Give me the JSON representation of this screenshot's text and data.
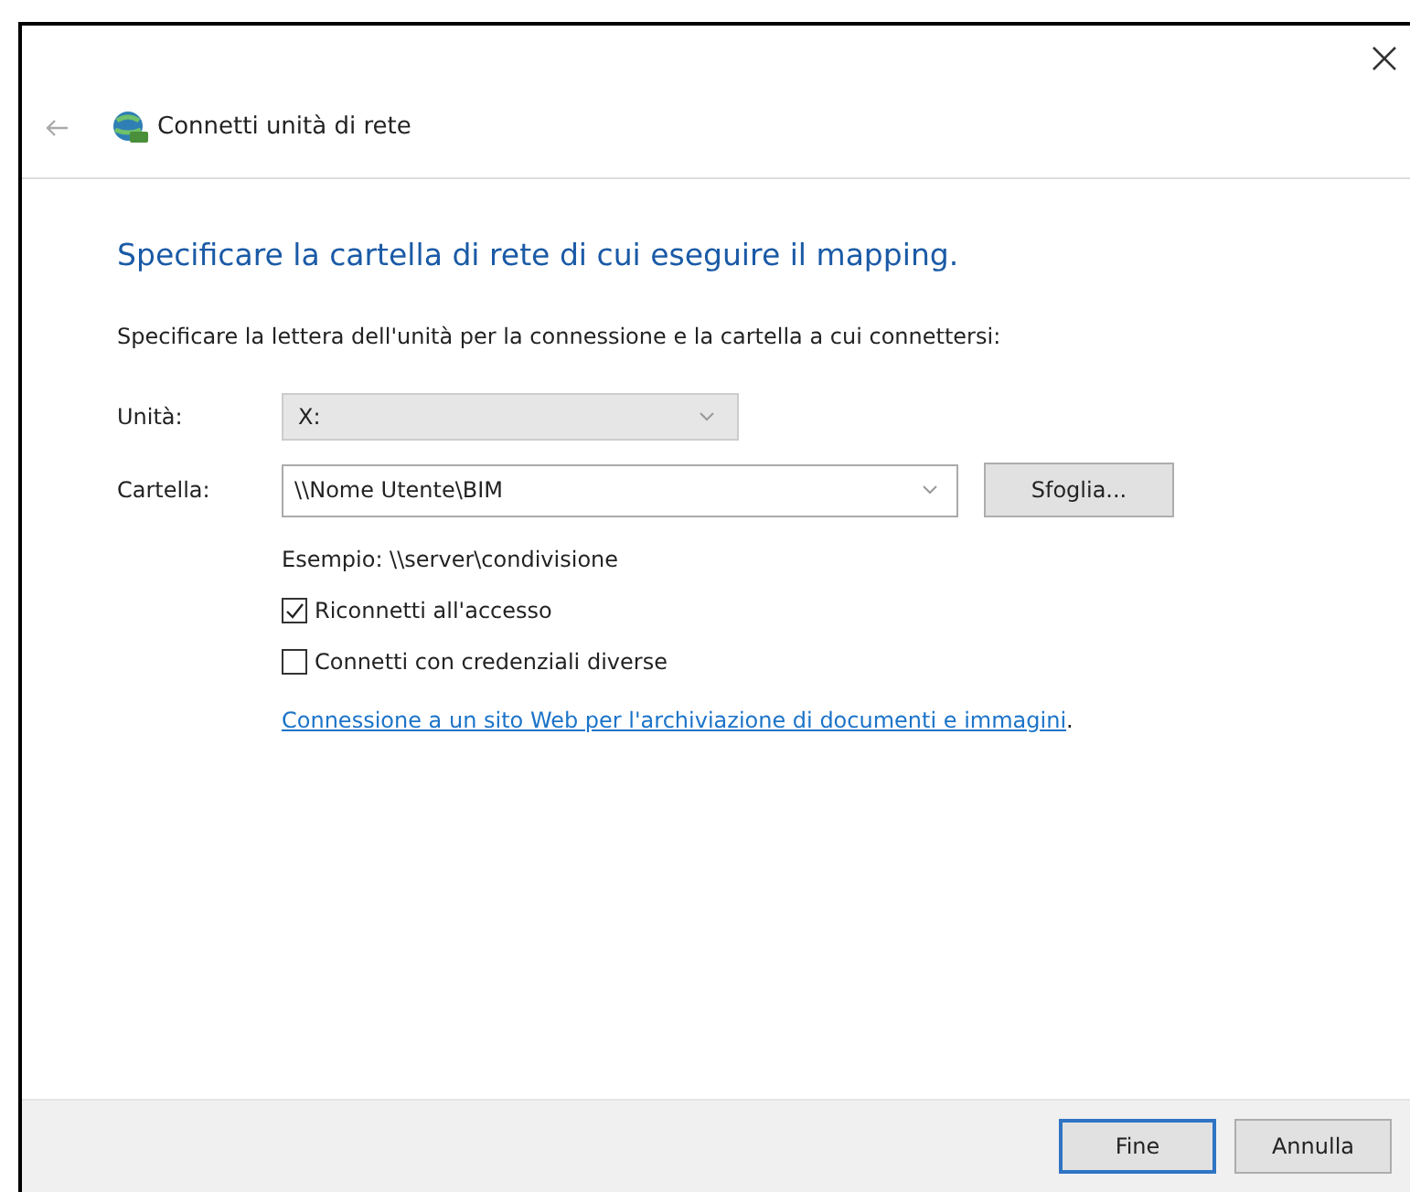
{
  "window": {
    "title": "Connetti unità di rete"
  },
  "heading": "Specificare la cartella di rete di cui eseguire il mapping.",
  "instruction": "Specificare la lettera dell'unità per la connessione e la cartella a cui connettersi:",
  "drive": {
    "label": "Unità:",
    "value": "X:"
  },
  "folder": {
    "label": "Cartella:",
    "value": "\\\\Nome Utente\\BIM",
    "browse": "Sfoglia..."
  },
  "example": "Esempio: \\\\server\\condivisione",
  "options": [
    {
      "label": "Riconnetti all'accesso",
      "checked": true
    },
    {
      "label": "Connetti con credenziali diverse",
      "checked": false
    }
  ],
  "link": "Connessione a un sito Web per l'archiviazione di documenti e immagini",
  "link_suffix": ".",
  "buttons": [
    {
      "label": "Fine",
      "default": true
    },
    {
      "label": "Annulla",
      "default": false
    }
  ]
}
